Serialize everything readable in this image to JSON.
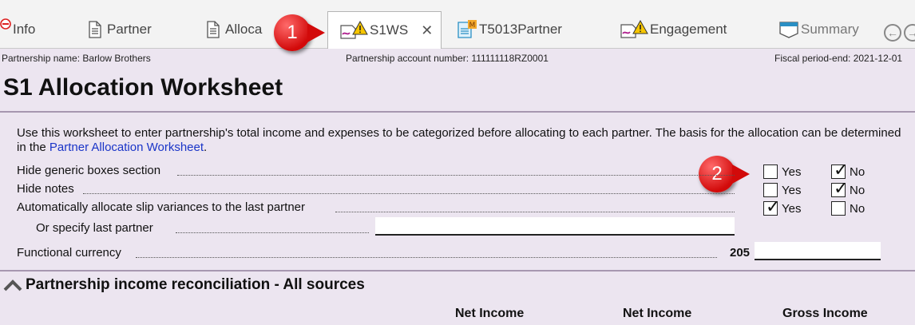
{
  "tabs": [
    {
      "label": "Info"
    },
    {
      "label": "Partner"
    },
    {
      "label": "Alloca"
    },
    {
      "label": "S1WS",
      "active": true
    },
    {
      "label": "T5013Partner"
    },
    {
      "label": "Engagement"
    },
    {
      "label": "Summary"
    }
  ],
  "callouts": [
    "1",
    "2"
  ],
  "header": {
    "partnership_name": "Partnership name: Barlow Brothers",
    "account_number": "Partnership account number: 111111118RZ0001",
    "fiscal_period": "Fiscal period-end: 2021-12-01"
  },
  "title": "S1 Allocation Worksheet",
  "description": {
    "text": "Use this worksheet to enter partnership's total income and expenses to be categorized before allocating to each partner. The basis for the allocation can be determined in the ",
    "link": "Partner Allocation Worksheet",
    "end": "."
  },
  "options": {
    "hide_generic": {
      "label": "Hide generic boxes section",
      "yes": false,
      "no": true
    },
    "hide_notes": {
      "label": "Hide notes",
      "yes": false,
      "no": true
    },
    "auto_allocate": {
      "label": "Automatically allocate slip variances to the last partner",
      "yes": true,
      "no": false
    },
    "yes_label": "Yes",
    "no_label": "No"
  },
  "specify_last_partner": {
    "label": "Or specify last partner",
    "value": ""
  },
  "functional_currency": {
    "label": "Functional currency",
    "code": "205",
    "value": ""
  },
  "section": {
    "title": "Partnership income reconciliation - All sources"
  },
  "columns": [
    "Net Income",
    "Net Income",
    "Gross Income"
  ],
  "colors": {
    "accent": "#d20a0a",
    "link": "#1a35c8",
    "background": "#ece5f0"
  }
}
